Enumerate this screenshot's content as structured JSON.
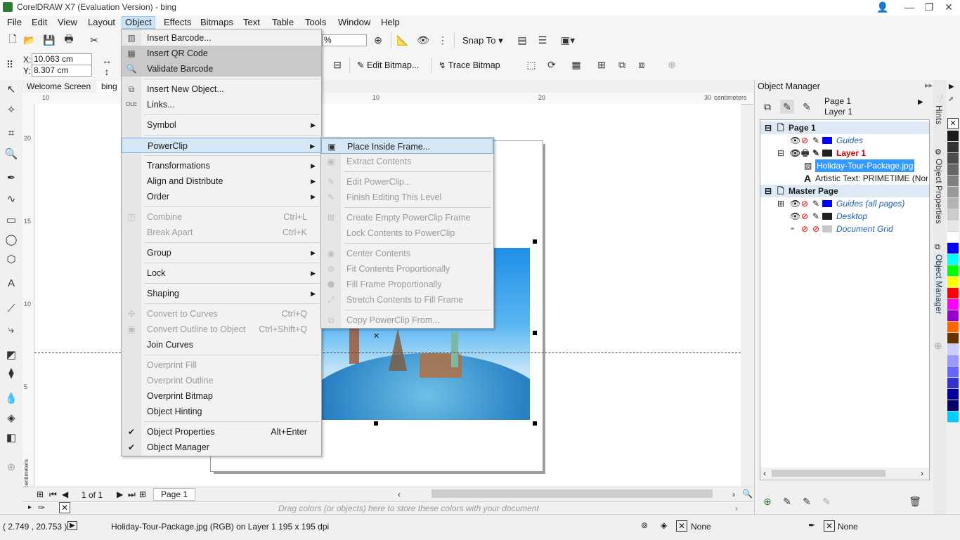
{
  "window": {
    "title": "CorelDRAW X7 (Evaluation Version) - bing"
  },
  "menubar": [
    "File",
    "Edit",
    "View",
    "Layout",
    "Object",
    "Effects",
    "Bitmaps",
    "Text",
    "Table",
    "Tools",
    "Window",
    "Help"
  ],
  "toolbar": {
    "snap_to": "Snap To",
    "zoom_suffix": "%"
  },
  "propertybar": {
    "x_label": "X:",
    "x_value": "10.063 cm",
    "y_label": "Y:",
    "y_value": "8.307 cm",
    "edit_bitmap": "Edit Bitmap...",
    "trace_bitmap": "Trace Bitmap"
  },
  "doctabs": {
    "welcome": "Welcome Screen",
    "bing": "bing"
  },
  "ruler": {
    "h_ticks": [
      "10",
      "10",
      "20",
      "30"
    ],
    "unit": "centimeters",
    "v_ticks": [
      "20",
      "15",
      "10",
      "5"
    ],
    "v_unit": "centimeters"
  },
  "object_menu": {
    "items": [
      {
        "label": "Insert Barcode...",
        "state": "normal"
      },
      {
        "label": "Insert QR Code",
        "state": "hover"
      },
      {
        "label": "Validate Barcode",
        "state": "hover"
      },
      {
        "label": "Insert New Object...",
        "state": "normal"
      },
      {
        "label": "Links...",
        "state": "normal"
      },
      {
        "label": "Symbol",
        "state": "normal",
        "submenu": true
      },
      {
        "label": "PowerClip",
        "state": "active",
        "submenu": true
      },
      {
        "label": "Transformations",
        "state": "normal",
        "submenu": true
      },
      {
        "label": "Align and Distribute",
        "state": "normal",
        "submenu": true
      },
      {
        "label": "Order",
        "state": "normal",
        "submenu": true
      },
      {
        "label": "Combine",
        "state": "disabled",
        "shortcut": "Ctrl+L"
      },
      {
        "label": "Break Apart",
        "state": "disabled",
        "shortcut": "Ctrl+K"
      },
      {
        "label": "Group",
        "state": "normal",
        "submenu": true
      },
      {
        "label": "Lock",
        "state": "normal",
        "submenu": true
      },
      {
        "label": "Shaping",
        "state": "normal",
        "submenu": true
      },
      {
        "label": "Convert to Curves",
        "state": "disabled",
        "shortcut": "Ctrl+Q"
      },
      {
        "label": "Convert Outline to Object",
        "state": "disabled",
        "shortcut": "Ctrl+Shift+Q"
      },
      {
        "label": "Join Curves",
        "state": "normal"
      },
      {
        "label": "Overprint Fill",
        "state": "disabled"
      },
      {
        "label": "Overprint Outline",
        "state": "disabled"
      },
      {
        "label": "Overprint Bitmap",
        "state": "normal"
      },
      {
        "label": "Object Hinting",
        "state": "normal"
      },
      {
        "label": "Object Properties",
        "state": "checked",
        "shortcut": "Alt+Enter"
      },
      {
        "label": "Object Manager",
        "state": "checked"
      }
    ]
  },
  "powerclip_menu": {
    "items": [
      {
        "label": "Place Inside Frame...",
        "state": "hover"
      },
      {
        "label": "Extract Contents",
        "state": "disabled"
      },
      {
        "label": "Edit PowerClip...",
        "state": "disabled"
      },
      {
        "label": "Finish Editing This Level",
        "state": "disabled"
      },
      {
        "label": "Create Empty PowerClip Frame",
        "state": "disabled"
      },
      {
        "label": "Lock Contents to PowerClip",
        "state": "disabled"
      },
      {
        "label": "Center Contents",
        "state": "disabled"
      },
      {
        "label": "Fit Contents Proportionally",
        "state": "disabled"
      },
      {
        "label": "Fill Frame Proportionally",
        "state": "disabled"
      },
      {
        "label": "Stretch Contents to Fill Frame",
        "state": "disabled"
      },
      {
        "label": "Copy PowerClip From...",
        "state": "disabled"
      }
    ]
  },
  "object_manager": {
    "title": "Object Manager",
    "page_label": "Page 1",
    "layer_label": "Layer 1",
    "tree": [
      {
        "label": "Page 1",
        "kind": "header"
      },
      {
        "label": "Guides",
        "kind": "layer",
        "color": "#0000ff"
      },
      {
        "label": "Layer 1",
        "kind": "active-layer",
        "color": "#202020"
      },
      {
        "label": "Holiday-Tour-Package.jpg",
        "kind": "object-selected"
      },
      {
        "label": "Artistic Text: PRIMETIME (Norr",
        "kind": "object"
      },
      {
        "label": "Master Page",
        "kind": "header"
      },
      {
        "label": "Guides (all pages)",
        "kind": "layer",
        "color": "#0000ff"
      },
      {
        "label": "Desktop",
        "kind": "layer",
        "color": "#202020"
      },
      {
        "label": "Document Grid",
        "kind": "layer",
        "color": "#c8c8c8"
      }
    ]
  },
  "docker_tabs": [
    "Hints",
    "Object Properties",
    "Object Manager"
  ],
  "pagenav": {
    "count": "1 of 1",
    "page_tab": "Page 1"
  },
  "colorwell_hint": "Drag colors (or objects) here to store these colors with your document",
  "status": {
    "coords": "( 2.749 , 20.753 )",
    "info": "Holiday-Tour-Package.jpg (RGB) on Layer 1 195 x 195 dpi",
    "fill": "None",
    "outline": "None"
  },
  "palette": [
    "#ffffff",
    "#000000",
    "#1a1a1a",
    "#333333",
    "#4d4d4d",
    "#666666",
    "#808080",
    "#999999",
    "#b3b3b3",
    "#cccccc",
    "#e6e6e6",
    "#ffffff",
    "#0000ff",
    "#00ffff",
    "#00ff00",
    "#ffff00",
    "#ff0000",
    "#ff00ff",
    "#9900cc",
    "#ff6600",
    "#663300",
    "#ccccff",
    "#9999ff",
    "#6666ff",
    "#3333cc",
    "#000099",
    "#000066",
    "#00ccff"
  ]
}
